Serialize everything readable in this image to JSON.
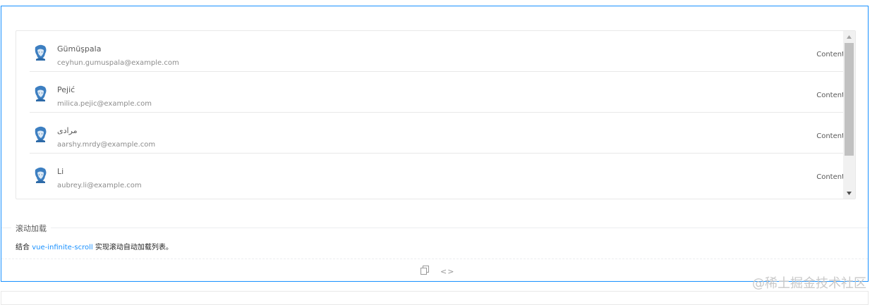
{
  "list": {
    "items": [
      {
        "name": "Gümüşpala",
        "email": "ceyhun.gumuspala@example.com",
        "content": "Content"
      },
      {
        "name": "Pejić",
        "email": "milica.pejic@example.com",
        "content": "Content"
      },
      {
        "name": "مرادی",
        "email": "aarshy.mrdy@example.com",
        "content": "Content"
      },
      {
        "name": "Li",
        "email": "aubrey.li@example.com",
        "content": "Content"
      }
    ]
  },
  "meta": {
    "title": "滚动加载",
    "desc_prefix": "结合",
    "desc_link": "vue-infinite-scroll",
    "desc_suffix": "实现滚动自动加载列表。"
  },
  "watermark": "@稀土掘金技术社区",
  "icons": {
    "copy": "copy-icon",
    "code": "code-icon",
    "avatar": "avatar-icon"
  },
  "colors": {
    "accent": "#1890ff",
    "border": "#e8e8e8"
  }
}
